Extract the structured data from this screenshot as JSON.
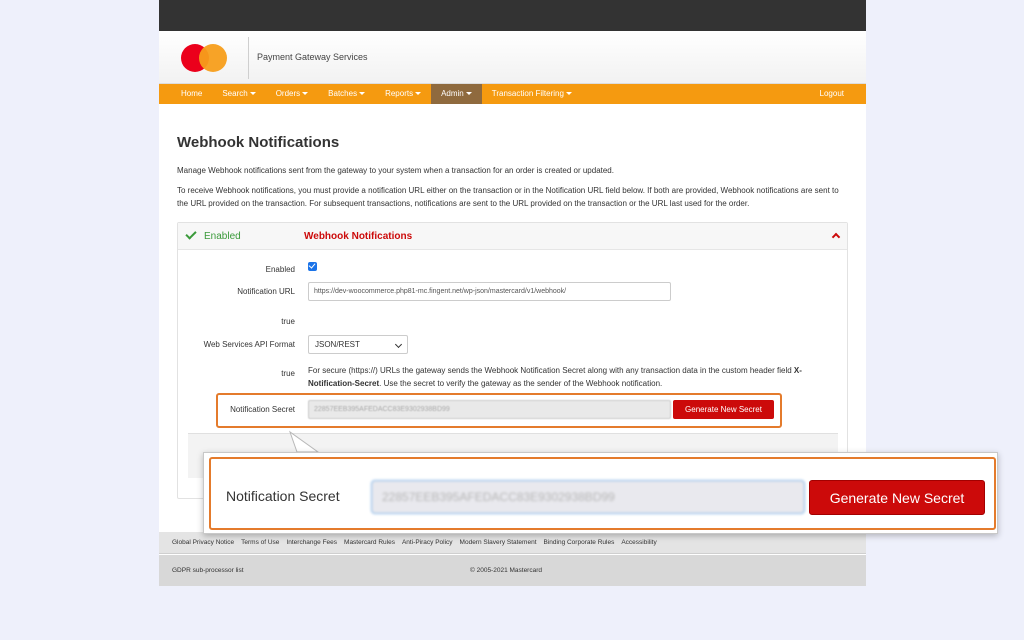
{
  "brand": {
    "name": "Payment Gateway Services"
  },
  "nav": {
    "items": [
      {
        "label": "Home",
        "dropdown": false
      },
      {
        "label": "Search",
        "dropdown": true
      },
      {
        "label": "Orders",
        "dropdown": true
      },
      {
        "label": "Batches",
        "dropdown": true
      },
      {
        "label": "Reports",
        "dropdown": true
      },
      {
        "label": "Admin",
        "dropdown": true,
        "active": true
      },
      {
        "label": "Transaction Filtering",
        "dropdown": true
      }
    ],
    "logout": "Logout"
  },
  "page": {
    "title": "Webhook Notifications",
    "intro": "Manage Webhook notifications sent from the gateway to your system when a transaction for an order is created or updated.",
    "details": "To receive Webhook notifications, you must provide a notification URL either on the transaction or in the Notification URL field below. If both are provided, Webhook notifications are sent to the URL provided on the transaction. For subsequent transactions, notifications are sent to the URL provided on the transaction or the URL last used for the order."
  },
  "panel": {
    "status": "Enabled",
    "title": "Webhook Notifications",
    "fields": {
      "enabled_label": "Enabled",
      "enabled_checked": true,
      "url_label": "Notification URL",
      "url_value": "https://dev-woocommerce.php81-mc.fingent.net/wp-json/mastercard/v1/webhook/",
      "true_label_1": "true",
      "format_label": "Web Services API Format",
      "format_value": "JSON/REST",
      "true_label_2": "true",
      "help_text_1": "For secure (https://) URLs the gateway sends the Webhook Notification Secret along with any transaction data in the custom header field",
      "help_text_2": "X-Notification-Secret",
      "help_text_3": ". Use the secret to verify the gateway as the sender of the Webhook notification.",
      "secret_label": "Notification Secret",
      "secret_value": "22857EEB395AFEDACC83E9302938BD99",
      "generate_button": "Generate New Secret"
    }
  },
  "footer": {
    "links": [
      "Global Privacy Notice",
      "Terms of Use",
      "Interchange Fees",
      "Mastercard Rules",
      "Anti-Piracy Policy",
      "Modern Slavery Statement",
      "Binding Corporate Rules",
      "Accessibility"
    ],
    "gdpr": "GDPR sub-processor list",
    "copyright": "© 2005-2021 Mastercard"
  },
  "callout": {
    "label": "Notification Secret",
    "secret_value": "22857EEB395AFEDACC83E9302938BD99",
    "button": "Generate New Secret"
  },
  "colors": {
    "accent_orange": "#f59a10",
    "brand_red": "#cc0a0a",
    "highlight": "#e47b2c",
    "enabled_green": "#3a9a3a"
  }
}
